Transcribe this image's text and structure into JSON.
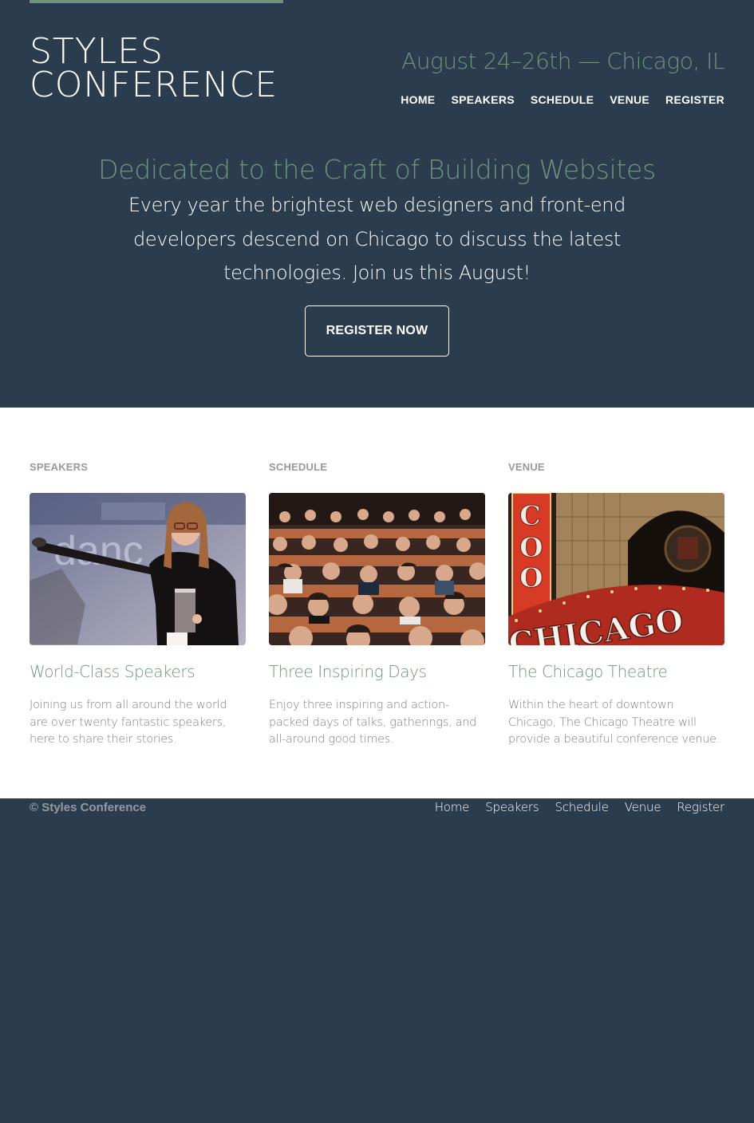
{
  "header": {
    "logo_line1": "STYLES",
    "logo_line2": "CONFERENCE",
    "tagline": "August 24–26th — Chicago, IL",
    "nav": [
      "HOME",
      "SPEAKERS",
      "SCHEDULE",
      "VENUE",
      "REGISTER"
    ]
  },
  "hero": {
    "title": "Dedicated to the Craft of Building Websites",
    "text": "Every year the brightest web designers and front-end developers descend on Chicago to discuss the latest technologies. Join us this August!",
    "button": "REGISTER NOW"
  },
  "columns": [
    {
      "label": "SPEAKERS",
      "title": "World-Class Speakers",
      "text": "Joining us from all around the world are over twenty fantastic speakers, here to share their stories."
    },
    {
      "label": "SCHEDULE",
      "title": "Three Inspiring Days",
      "text": "Enjoy three inspiring and action-packed days of talks, gatherings, and all-around good times."
    },
    {
      "label": "VENUE",
      "title": "The Chicago Theatre",
      "text": "Within the heart of downtown Chicago, The Chicago Theatre will provide a beautiful conference venue.",
      "sign_text": "CHICAGO"
    }
  ],
  "footer": {
    "copyright": "© Styles Conference",
    "nav": [
      "Home",
      "Speakers",
      "Schedule",
      "Venue",
      "Register"
    ]
  },
  "colors": {
    "background": "#2a3c4e",
    "accent": "#6f947b",
    "muted": "#9799a0"
  }
}
